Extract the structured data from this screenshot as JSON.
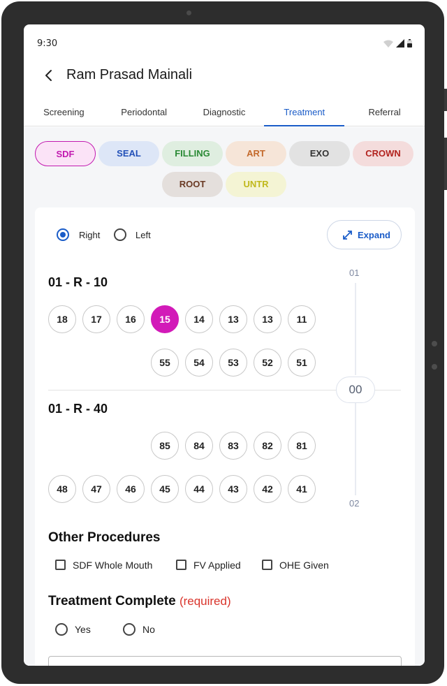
{
  "status": {
    "time": "9:30"
  },
  "header": {
    "title": "Ram Prasad Mainali"
  },
  "tabs": [
    {
      "label": "Screening"
    },
    {
      "label": "Periodontal"
    },
    {
      "label": "Diagnostic"
    },
    {
      "label": "Treatment",
      "active": true
    },
    {
      "label": "Referral"
    }
  ],
  "chips": [
    {
      "label": "SDF",
      "color": "#c21ab0",
      "bg": "#fbe3f7",
      "selected": true
    },
    {
      "label": "SEAL",
      "color": "#2250b8",
      "bg": "#dde6f7"
    },
    {
      "label": "FILLING",
      "color": "#2a8a35",
      "bg": "#dfeee0"
    },
    {
      "label": "ART",
      "color": "#c46a2c",
      "bg": "#f6e5d8"
    },
    {
      "label": "EXO",
      "color": "#333333",
      "bg": "#e2e2e2"
    },
    {
      "label": "CROWN",
      "color": "#b2231f",
      "bg": "#f4dcdc"
    },
    {
      "label": "ROOT",
      "color": "#6a3a24",
      "bg": "#e4dfdc"
    },
    {
      "label": "UNTR",
      "color": "#c0b81c",
      "bg": "#f4f4d4"
    }
  ],
  "side": {
    "right_label": "Right",
    "left_label": "Left",
    "selected": "Right"
  },
  "expand_label": "Expand",
  "quadrant_upper": {
    "title": "01 - R - 10",
    "permanent": [
      "18",
      "17",
      "16",
      "15",
      "14",
      "13",
      "13",
      "11"
    ],
    "primary": [
      "55",
      "54",
      "53",
      "52",
      "51"
    ],
    "selected": "15"
  },
  "quadrant_lower": {
    "title": "01 - R - 40",
    "primary": [
      "85",
      "84",
      "83",
      "82",
      "81"
    ],
    "permanent": [
      "48",
      "47",
      "46",
      "45",
      "44",
      "43",
      "42",
      "41"
    ]
  },
  "scroller": {
    "top": "01",
    "middle": "00",
    "bottom": "02"
  },
  "other_procedures": {
    "title": "Other Procedures",
    "items": [
      "SDF Whole Mouth",
      "FV Applied",
      "OHE Given"
    ]
  },
  "treatment_complete": {
    "title": "Treatment Complete",
    "required": "(required)",
    "options": [
      "Yes",
      "No"
    ]
  },
  "colors": {
    "accent": "#1a5cc8",
    "selected_tooth": "#d21ab8",
    "required": "#d9342b"
  }
}
